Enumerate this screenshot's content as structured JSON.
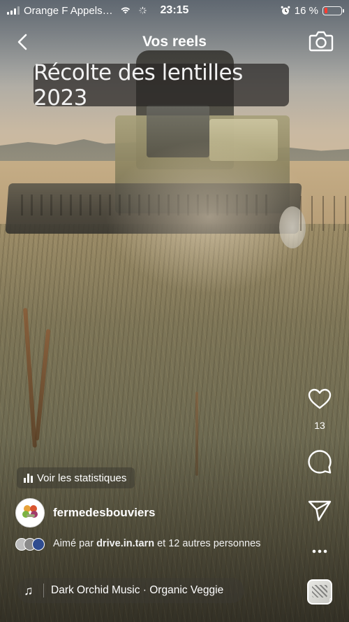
{
  "status_bar": {
    "carrier": "Orange F Appels…",
    "time": "23:15",
    "battery_percent": "16 %",
    "battery_level": 0.16,
    "battery_color": "#ff3b30",
    "icons": [
      "signal-icon",
      "wifi-icon",
      "loading-spinner-icon",
      "alarm-icon",
      "battery-icon"
    ]
  },
  "nav": {
    "back_icon": "chevron-left-icon",
    "title": "Vos reels",
    "camera_icon": "camera-icon"
  },
  "video": {
    "caption_overlay": "Récolte des lentilles 2023"
  },
  "actions": {
    "like_icon": "heart-icon",
    "like_count": "13",
    "comment_icon": "comment-icon",
    "share_icon": "send-icon",
    "more_icon": "more-dots-icon",
    "audio_thumb_icon": "music-note-icon"
  },
  "insights": {
    "label": "Voir les statistiques",
    "icon": "bar-chart-icon"
  },
  "author": {
    "username": "fermedesbouviers"
  },
  "likes": {
    "prefix": "Aimé par ",
    "liker": "drive.in.tarn",
    "suffix": " et 12 autres personnes"
  },
  "music": {
    "icon": "music-note-icon",
    "text": "Dark Orchid Music · Organic Veggie"
  }
}
